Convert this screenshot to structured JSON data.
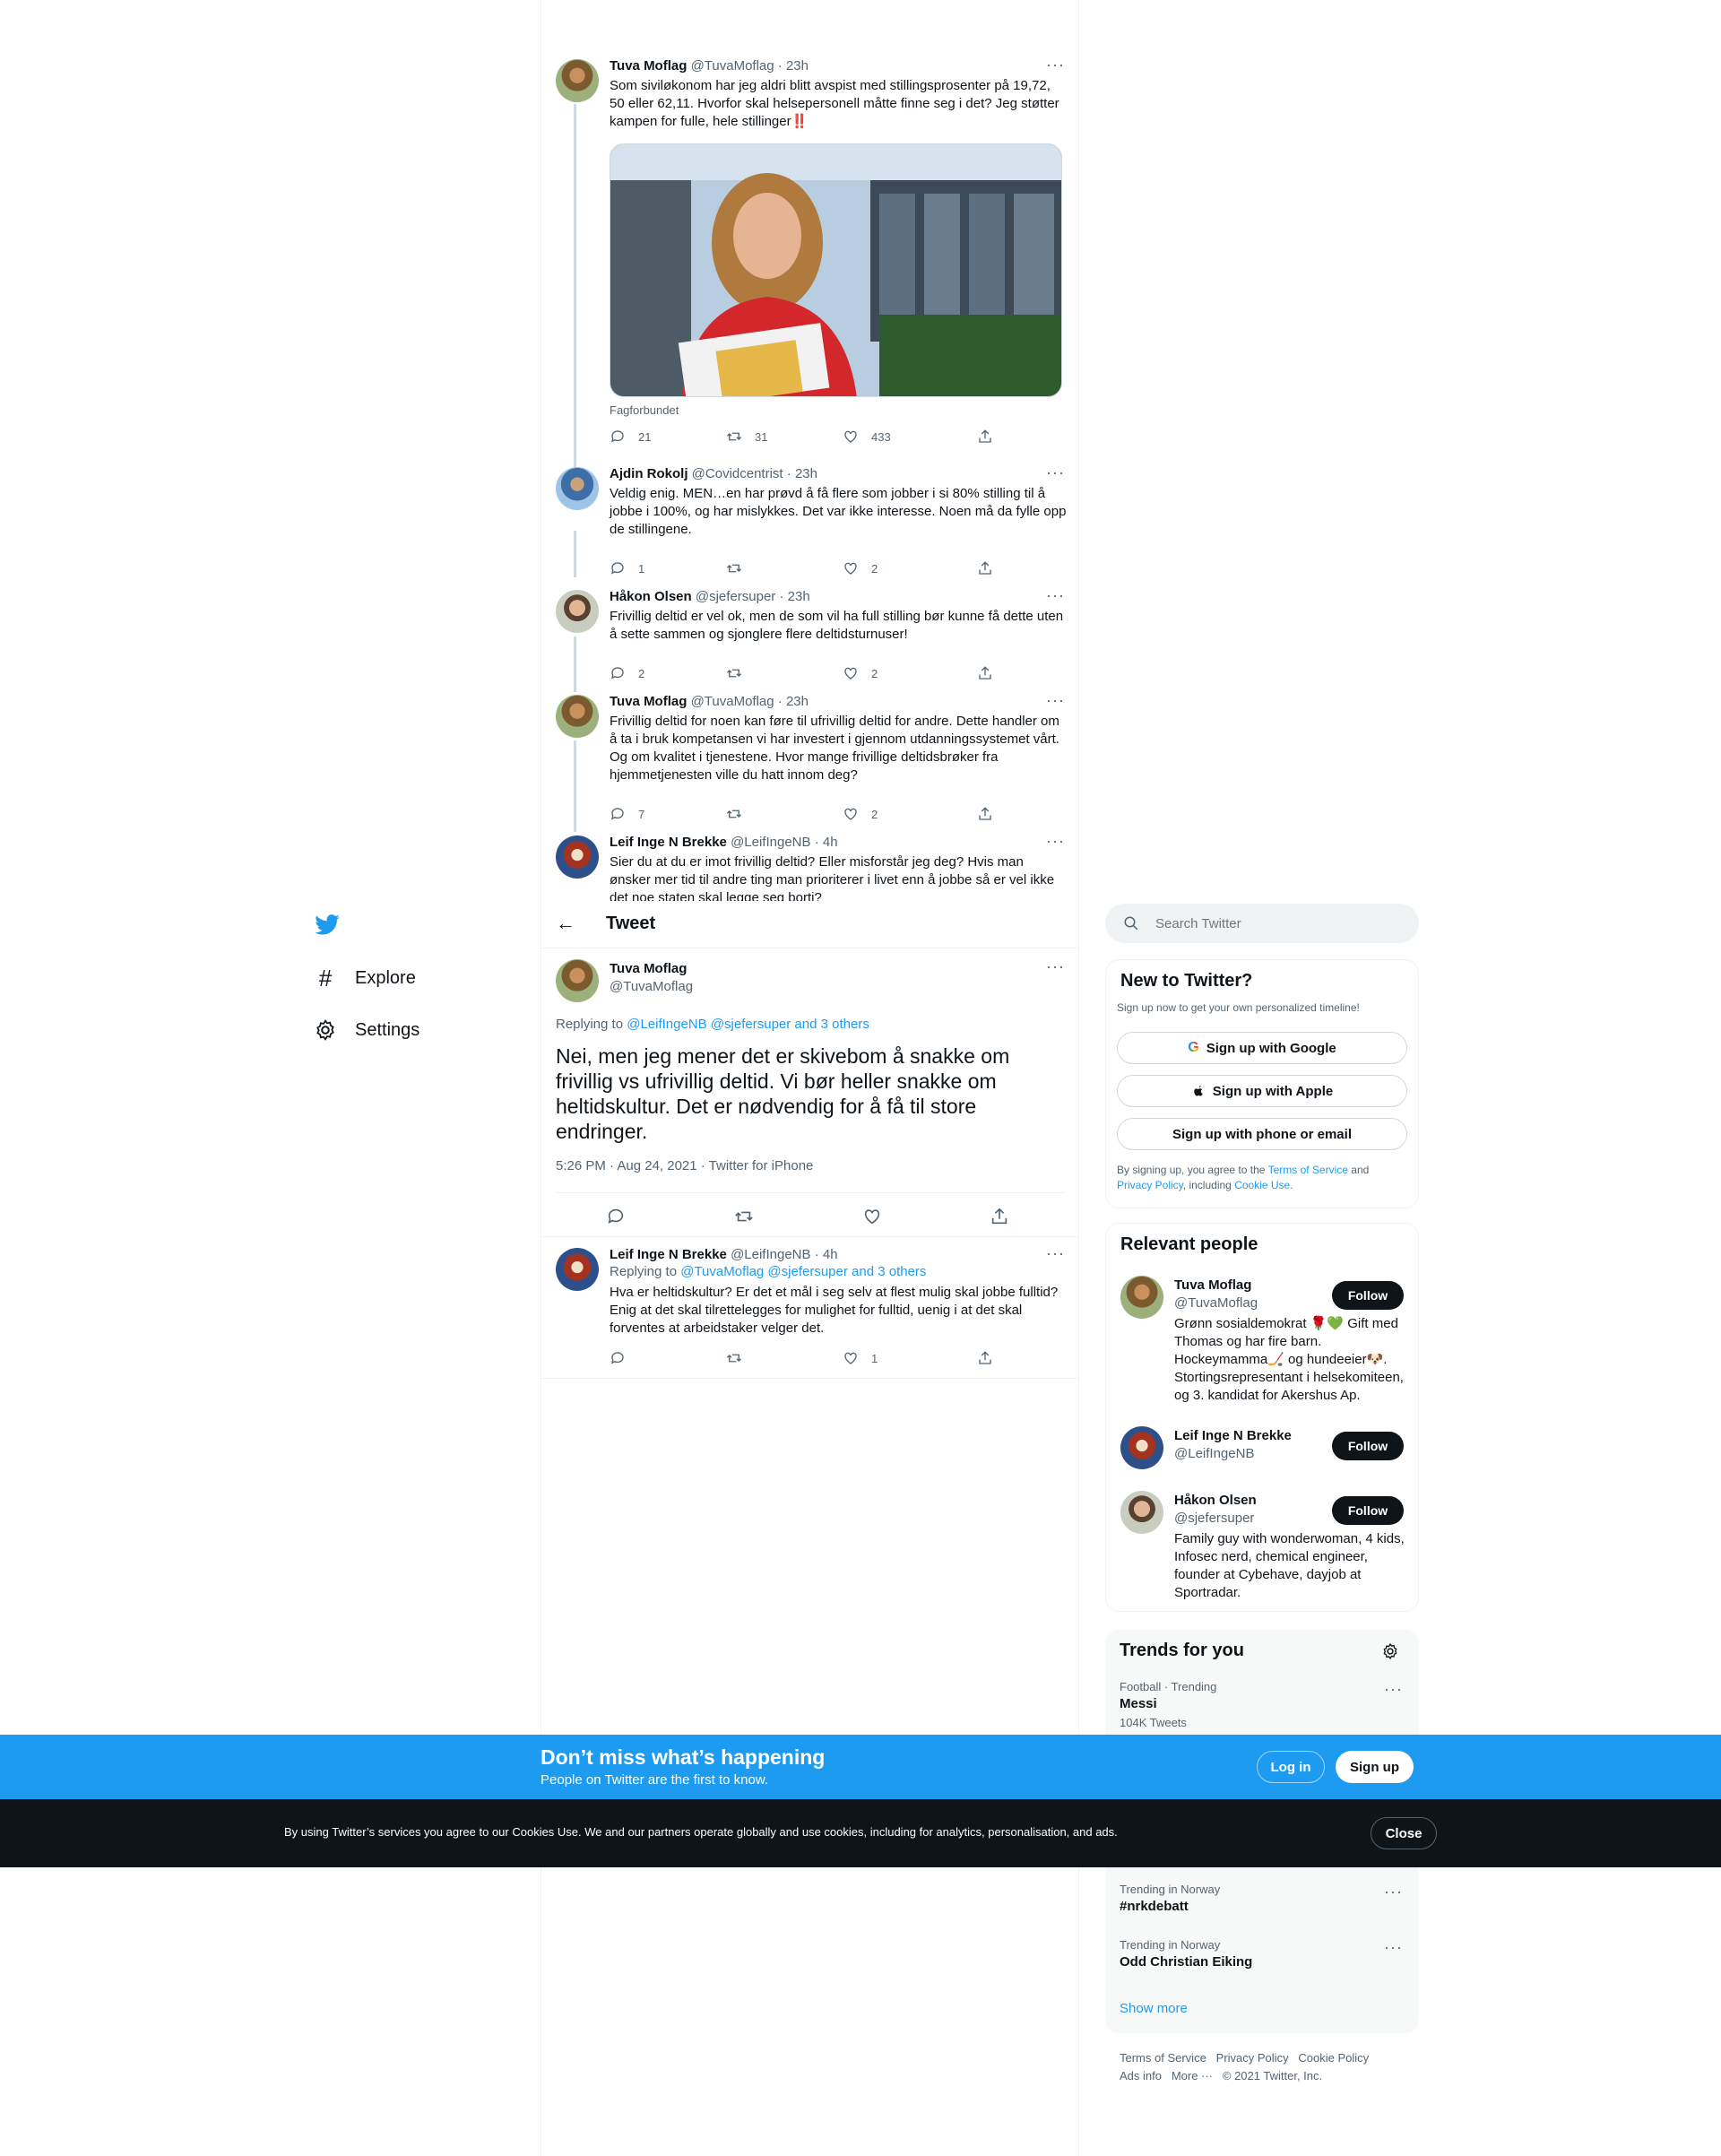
{
  "nav": {
    "explore_label": "Explore",
    "settings_label": "Settings"
  },
  "header": {
    "title": "Tweet"
  },
  "thread": [
    {
      "name": "Tuva Moflag",
      "handle": "@TuvaMoflag",
      "time": "· 23h",
      "text": "Som siviløkonom har jeg aldri blitt avspist med stillingsprosenter på 19,72, 50 eller 62,11. Hvorfor skal helsepersonell måtte finne seg i det? Jeg støtter kampen for fulle, hele stillinger‼️",
      "media_caption": "Fagforbundet",
      "replies": "21",
      "retweets": "31",
      "likes": "433"
    },
    {
      "name": "Ajdin Rokolj",
      "handle": "@Covidcentrist",
      "time": "· 23h",
      "text": "Veldig enig. MEN…en har prøvd å få flere som jobber i si 80% stilling til å jobbe i 100%, og har mislykkes. Det var ikke interesse. Noen må da fylle opp de stillingene.",
      "replies": "1",
      "retweets": "",
      "likes": "2"
    },
    {
      "name": "Håkon Olsen",
      "handle": "@sjefersuper",
      "time": "· 23h",
      "text": "Frivillig deltid er vel ok, men de som vil ha full stilling bør kunne få dette uten å sette sammen og sjonglere flere deltidsturnuser!",
      "replies": "2",
      "retweets": "",
      "likes": "2"
    },
    {
      "name": "Tuva Moflag",
      "handle": "@TuvaMoflag",
      "time": "· 23h",
      "text": "Frivillig deltid for noen kan føre til ufrivillig deltid for andre. Dette handler om å ta i bruk kompetansen vi har investert i gjennom utdanningssystemet vårt. Og om kvalitet i tjenestene. Hvor mange frivillige deltidsbrøker fra hjemmetjenesten ville du hatt innom deg?",
      "replies": "7",
      "retweets": "",
      "likes": "2"
    },
    {
      "name": "Leif Inge N Brekke",
      "handle": "@LeifIngeNB",
      "time": "· 4h",
      "text": "Sier du at du er imot frivillig deltid? Eller misforstår jeg deg? Hvis man ønsker mer tid til andre ting man prioriterer i livet enn å jobbe så er vel ikke det noe staten skal legge seg borti?"
    }
  ],
  "main_tweet": {
    "name": "Tuva Moflag",
    "handle": "@TuvaMoflag",
    "replying_prefix": "Replying to",
    "replying_to": "@LeifIngeNB @sjefersuper and 3 others",
    "text": "Nei, men jeg mener det er skivebom å snakke om frivillig vs ufrivillig deltid. Vi bør heller snakke om heltidskultur. Det er nødvendig for å få til store endringer.",
    "meta": "5:26 PM · Aug 24, 2021 · Twitter for iPhone"
  },
  "reply": {
    "name": "Leif Inge N Brekke",
    "handle": "@LeifIngeNB",
    "time": "· 4h",
    "replying_prefix": "Replying to",
    "replying_to": "@TuvaMoflag @sjefersuper and 3 others",
    "text": "Hva er heltidskultur? Er det et mål i seg selv at flest mulig skal jobbe fulltid? Enig at det skal tilrettelegges for mulighet for fulltid, uenig i at det skal forventes at arbeidstaker velger det.",
    "replies": "",
    "retweets": "",
    "likes": "1"
  },
  "search": {
    "placeholder": "Search Twitter"
  },
  "signup": {
    "title": "New to Twitter?",
    "subtitle": "Sign up now to get your own personalized timeline!",
    "google": "Sign up with Google",
    "apple": "Sign up with Apple",
    "phone": "Sign up with phone or email",
    "legal_1": "By signing up, you agree to the",
    "tos": "Terms of Service",
    "and": "and",
    "privacy": "Privacy Policy",
    "including": ", including",
    "cookie": "Cookie Use."
  },
  "relevant": {
    "title": "Relevant people",
    "follow_label": "Follow",
    "people": [
      {
        "name": "Tuva Moflag",
        "handle": "@TuvaMoflag",
        "bio": "Grønn sosialdemokrat 🌹💚 Gift med Thomas og har fire barn. Hockeymamma🏒 og hundeeier🐶. Stortingsrepresentant i helsekomiteen, og 3. kandidat for Akershus Ap."
      },
      {
        "name": "Leif Inge N Brekke",
        "handle": "@LeifIngeNB",
        "bio": ""
      },
      {
        "name": "Håkon Olsen",
        "handle": "@sjefersuper",
        "bio": "Family guy with wonderwoman, 4 kids, Infosec nerd, chemical engineer, founder at Cybehave, dayjob at Sportradar."
      }
    ]
  },
  "trends": {
    "title": "Trends for you",
    "items": [
      {
        "context": "Football · Trending",
        "name": "Messi",
        "count": "104K Tweets"
      },
      {
        "context": "Trending in Norway",
        "name": "#nrkdebatt",
        "count": ""
      },
      {
        "context": "Trending in Norway",
        "name": "Odd Christian Eiking",
        "count": ""
      }
    ],
    "show_more": "Show more"
  },
  "footer": {
    "terms": "Terms of Service",
    "privacy": "Privacy Policy",
    "cookie": "Cookie Policy",
    "ads": "Ads info",
    "more": "More ···",
    "copyright": "© 2021 Twitter, Inc."
  },
  "banner": {
    "title": "Don’t miss what’s happening",
    "subtitle": "People on Twitter are the first to know.",
    "login": "Log in",
    "signup": "Sign up"
  },
  "cookie_bar": {
    "text": "By using Twitter’s services you agree to our Cookies Use. We and our partners operate globally and use cookies, including for analytics, personalisation, and ads.",
    "close": "Close"
  },
  "colors": {
    "brand": "#1d9bf0",
    "text": "#0f1419",
    "muted": "#536471",
    "cookie_bg": "#0f1419"
  }
}
